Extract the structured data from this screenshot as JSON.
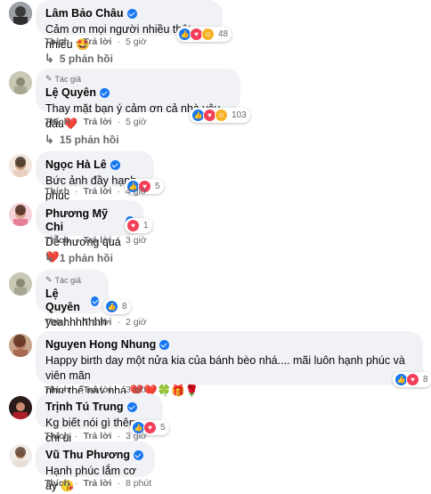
{
  "common": {
    "like": "Thích",
    "reply": "Trả lời",
    "author_tag": "Tác giả"
  },
  "comments": [
    {
      "name": "Lâm Bảo Châu",
      "text": "Cảm ơn mọi người nhiều thật nhiều 🤩",
      "time": "5 giờ",
      "reactions": "48",
      "replies": "5 phản hồi"
    },
    {
      "name": "Lệ Quyên",
      "text": "Thay mặt bạn ý cảm ơn cả nhà yêu dấu❤️",
      "time": "5 giờ",
      "reactions": "103",
      "replies": "15 phản hồi"
    },
    {
      "name": "Ngọc Hà Lê",
      "text": "Bức ảnh đầy hạnh phúc",
      "time": "4 giờ",
      "reactions": "5"
    },
    {
      "name": "Phương Mỹ Chi",
      "text": "Dễ thương quá ❤️",
      "time": "3 giờ",
      "reactions": "1",
      "replies": "1 phản hồi"
    },
    {
      "name": "Lệ Quyên",
      "text": "yeahhhhhhh",
      "time": "2 giờ",
      "reactions": "8"
    },
    {
      "name": "Nguyen Hong Nhung",
      "text": "Happy birth day một nửa kia của bánh bèo nhá.... mãi luôn hạnh phúc và viên mãn\nnhư thế này nhá ❤️❤️🍀🎁🌹",
      "time": "3 giờ",
      "reactions": "8"
    },
    {
      "name": "Trịnh Tú Trung",
      "text": "Kg biết nói gì thêm chị ui",
      "time": "3 giờ",
      "reactions": "5"
    },
    {
      "name": "Vũ Thu Phương",
      "text": "Hạnh phúc lắm cơ ấy 😘",
      "time": "8 phút"
    }
  ]
}
